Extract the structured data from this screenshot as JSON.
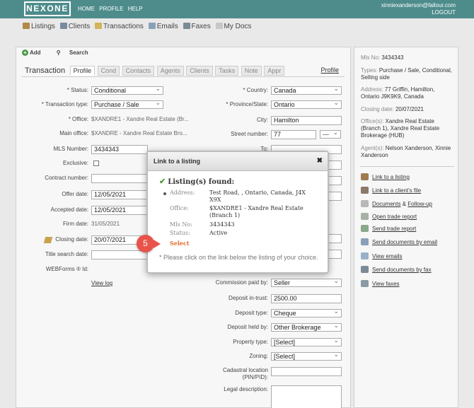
{
  "topbar": {
    "logo": "NEXONE",
    "nav": [
      "HOME",
      "PROFILE",
      "HELP"
    ],
    "user_email": "xinniexanderson@fallour.com",
    "logout": "LOGOUT"
  },
  "mainnav": [
    {
      "label": "Listings",
      "icon": "house-icon",
      "color": "#b08a4a"
    },
    {
      "label": "Clients",
      "icon": "people-icon",
      "color": "#7a8aa0"
    },
    {
      "label": "Transactions",
      "icon": "folder-icon",
      "color": "#d2b45a"
    },
    {
      "label": "Emails",
      "icon": "envelope-icon",
      "color": "#8aa0b8"
    },
    {
      "label": "Faxes",
      "icon": "fax-icon",
      "color": "#7a8a96"
    },
    {
      "label": "My Docs",
      "icon": "document-icon",
      "color": "#c8c8c8"
    }
  ],
  "toolbar": {
    "add": "Add",
    "search": "Search"
  },
  "tabs": {
    "title": "Transaction",
    "items": [
      "Profile",
      "Cond",
      "Contacts",
      "Agents",
      "Clients",
      "Tasks",
      "Note",
      "Appr"
    ],
    "profile_link": "Profile"
  },
  "form": {
    "status_label": "* Status:",
    "status_value": "Conditional",
    "trans_type_label": "* Transaction type:",
    "trans_type_value": "Purchase / Sale",
    "office_label": "* Office:",
    "office_value": "$XANDRE1 - Xandre Real Estate (Br...",
    "main_office_label": "Main office:",
    "main_office_value": "$XANDRE - Xandre Real Estate Bro...",
    "mls_label": "MLS Number:",
    "mls_value": "3434343",
    "exclusive_label": "Exclusive:",
    "contract_label": "Contract number:",
    "offer_label": "Offer date:",
    "offer_value": "12/05/2021",
    "accepted_label": "Accepted date:",
    "accepted_value": "12/05/2021",
    "firm_label": "Firm date:",
    "firm_value": "31/05/2021",
    "closing_label": "Closing date:",
    "closing_value": "20/07/2021",
    "title_search_label": "Title search date:",
    "webforms_label": "WEBForms ® Id:",
    "view_log": "View log",
    "country_label": "* Country:",
    "country_value": "Canada",
    "province_label": "* Province/State:",
    "province_value": "Ontario",
    "city_label": "City:",
    "city_value": "Hamilton",
    "street_label": "Street number:",
    "street_value": "77",
    "street_suffix": "---",
    "to_label": "To:",
    "commission_label": "Commission paid by:",
    "commission_value": "Seller",
    "deposit_trust_label": "Deposit in-trust:",
    "deposit_trust_value": "2500.00",
    "deposit_type_label": "Deposit type:",
    "deposit_type_value": "Cheque",
    "deposit_held_label": "Deposit held by:",
    "deposit_held_value": "Other Brokerage",
    "property_type_label": "Property type:",
    "property_type_value": "[Select]",
    "zoning_label": "Zoning:",
    "zoning_value": "[Select]",
    "cadastral_label": "Cadastral location (PIN/PID):",
    "legal_label": "Legal description:"
  },
  "sidebar": {
    "mls_label": "Mls No:",
    "mls_value": "3434343",
    "types_label": "Types:",
    "types_value": "Purchase / Sale, Conditional, Selling side",
    "address_label": "Address:",
    "address_value": "77 Griffin, Hamilton, Ontario J9K9K9, Canada",
    "closing_label": "Closing date:",
    "closing_value": "20/07/2021",
    "offices_label": "Office(s):",
    "offices_value": "Xandre Real Estate (Branch 1), Xandre Real Estate Brokerage (HUB)",
    "agents_label": "Agent(s):",
    "agents_value": "Nelson Xanderson, Xinnie Xanderson",
    "actions": [
      {
        "label": "Link to a listing",
        "icon": "house-icon"
      },
      {
        "label": "Link to a client's file",
        "icon": "person-icon"
      },
      {
        "label": "Documents",
        "extra": "Follow-up",
        "amp": "&",
        "icon": "document-icon"
      },
      {
        "label": "Open trade report",
        "icon": "report-icon"
      },
      {
        "label": "Send trade report",
        "icon": "send-report-icon"
      },
      {
        "label": "Send documents by email",
        "icon": "email-icon"
      },
      {
        "label": "View emails",
        "icon": "envelope-icon"
      },
      {
        "label": "Send documents by fax",
        "icon": "fax-icon"
      },
      {
        "label": "View faxes",
        "icon": "fax-icon"
      }
    ]
  },
  "modal": {
    "title": "Link to a listing",
    "found": "Listing(s) found:",
    "address_label": "Address:",
    "address_value": "Test Road, , Ontario, Canada, J4X X9X",
    "office_label": "Office:",
    "office_value": "$XANDRE1 - Xandre Real Estate (Branch 1)",
    "mls_label": "Mls No:",
    "mls_value": "3434343",
    "status_label": "Status:",
    "status_value": "Active",
    "select": "Select",
    "note": "* Please click on the link below the listing of your choice."
  },
  "step_badge": "5"
}
